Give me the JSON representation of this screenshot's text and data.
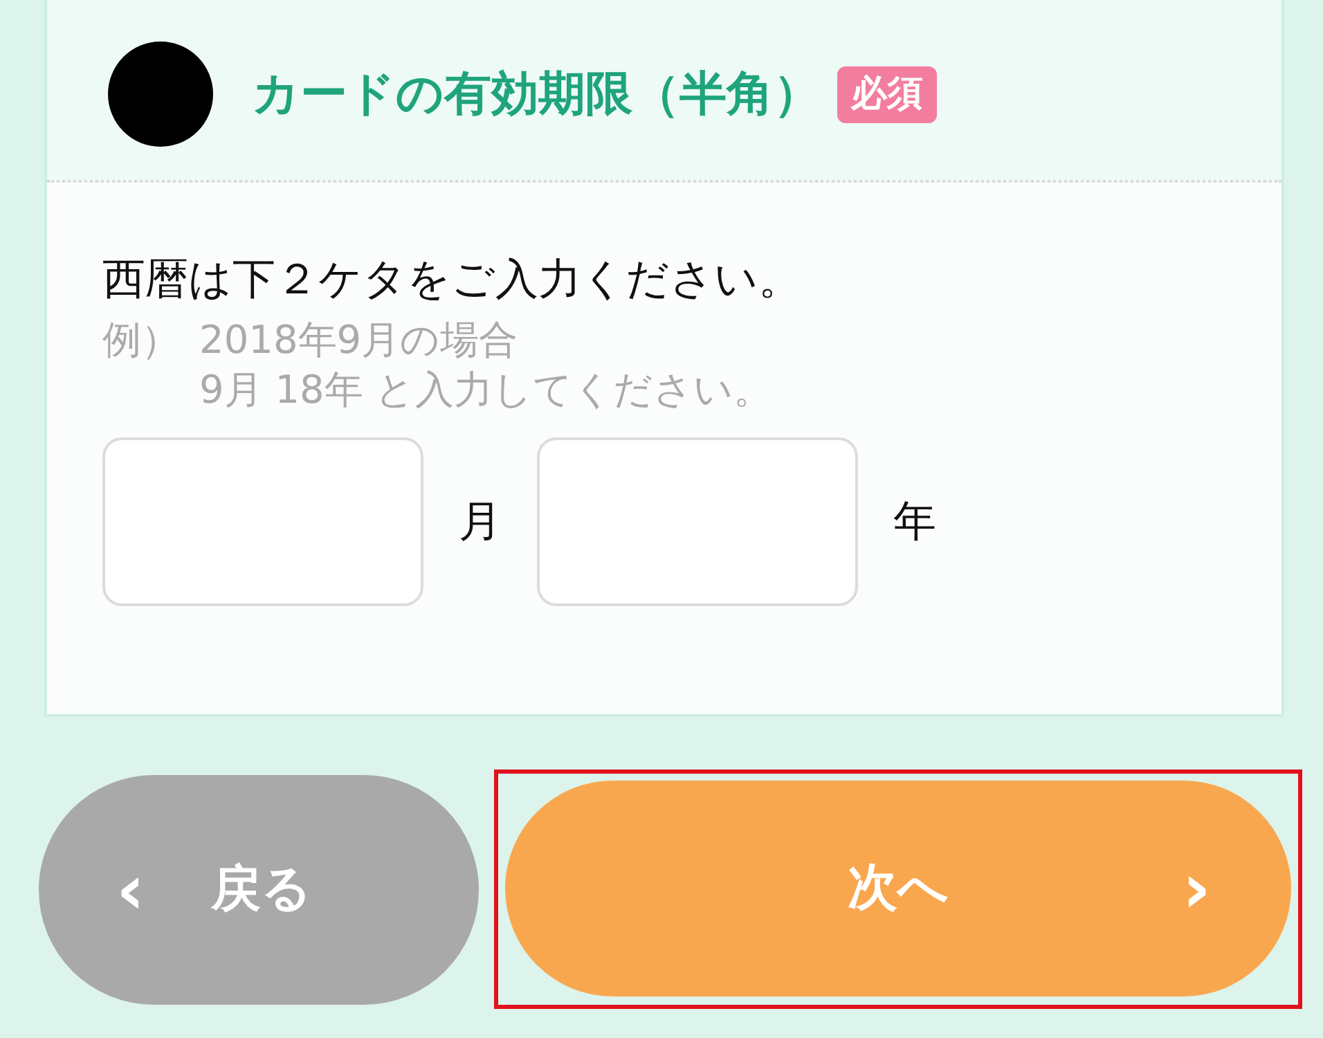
{
  "section": {
    "title": "カードの有効期限（半角）",
    "badge": "必須"
  },
  "instruction": "西暦は下２ケタをご入力ください。",
  "example": {
    "label": "例）",
    "lines": [
      "2018年9月の場合",
      "9月 18年 と入力してください。"
    ]
  },
  "fields": [
    {
      "unit": "月"
    },
    {
      "unit": "年"
    }
  ],
  "buttons": [
    {
      "kind": "back",
      "label": "戻る",
      "icon": "‹"
    },
    {
      "kind": "next",
      "label": "次へ",
      "icon": "›",
      "highlighted": true
    }
  ]
}
